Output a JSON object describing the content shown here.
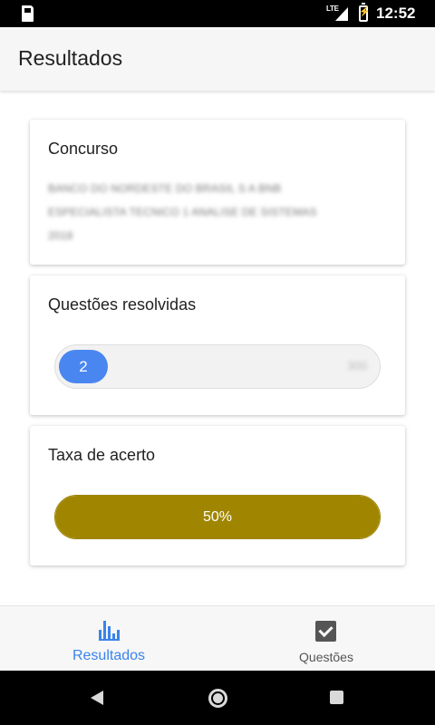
{
  "status_bar": {
    "network": "LTE",
    "time": "12:52"
  },
  "app_bar": {
    "title": "Resultados"
  },
  "cards": {
    "concurso": {
      "title": "Concurso",
      "text": "BANCO DO NORDESTE DO BRASIL S A BNB ESPECIALISTA TECNICO 1 ANALISE DE SISTEMAS 2018"
    },
    "questoes": {
      "title": "Questões resolvidas",
      "resolved": "2",
      "total": "300"
    },
    "taxa": {
      "title": "Taxa de acerto",
      "value_label": "50%",
      "fill_fraction": 1.0,
      "fill_color": "#a08600"
    }
  },
  "bottom_nav": {
    "items": [
      {
        "label": "Resultados",
        "icon": "bar-chart-icon",
        "active": true,
        "color": "#3a84ea"
      },
      {
        "label": "Questões",
        "icon": "check-box-icon",
        "active": false
      }
    ]
  },
  "system_nav": {
    "buttons": [
      "back-icon",
      "home-icon",
      "recents-icon"
    ]
  }
}
